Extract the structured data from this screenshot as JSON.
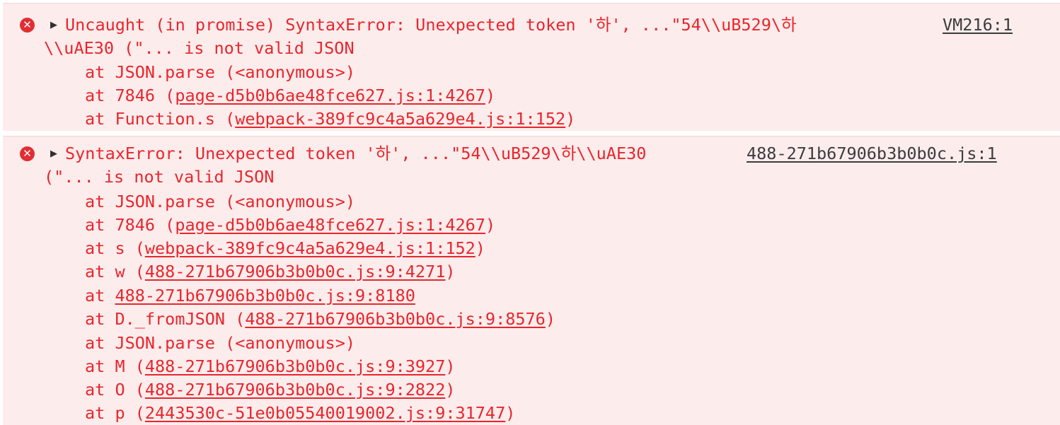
{
  "colors": {
    "error_text": "#e8262c",
    "error_bg": "#fcecec",
    "error_icon": "#e12e33",
    "link_text": "#4a4a4a"
  },
  "icons": {
    "error": "error-circle-icon",
    "expand": "expand-triangle-icon"
  },
  "entries": [
    {
      "message_line1": "Uncaught (in promise) SyntaxError: Unexpected token '하', ...\"54\\\\uB529\\하",
      "message_line2": "\\\\uAE30 (\"... is not valid JSON",
      "source": "VM216:1",
      "stack": [
        {
          "prefix": "at JSON.parse (<anonymous>)",
          "link": "",
          "suffix": ""
        },
        {
          "prefix": "at 7846 (",
          "link": "page-d5b0b6ae48fce627.js:1:4267",
          "suffix": ")"
        },
        {
          "prefix": "at Function.s (",
          "link": "webpack-389fc9c4a5a629e4.js:1:152",
          "suffix": ")"
        }
      ]
    },
    {
      "message_line1": "SyntaxError: Unexpected token '하', ...\"54\\\\uB529\\하\\\\uAE30",
      "message_line2": "(\"... is not valid JSON",
      "source": "488-271b67906b3b0b0c.js:1",
      "stack": [
        {
          "prefix": "at JSON.parse (<anonymous>)",
          "link": "",
          "suffix": ""
        },
        {
          "prefix": "at 7846 (",
          "link": "page-d5b0b6ae48fce627.js:1:4267",
          "suffix": ")"
        },
        {
          "prefix": "at s (",
          "link": "webpack-389fc9c4a5a629e4.js:1:152",
          "suffix": ")"
        },
        {
          "prefix": "at w (",
          "link": "488-271b67906b3b0b0c.js:9:4271",
          "suffix": ")"
        },
        {
          "prefix": "at ",
          "link": "488-271b67906b3b0b0c.js:9:8180",
          "suffix": ""
        },
        {
          "prefix": "at D._fromJSON (",
          "link": "488-271b67906b3b0b0c.js:9:8576",
          "suffix": ")"
        },
        {
          "prefix": "at JSON.parse (<anonymous>)",
          "link": "",
          "suffix": ""
        },
        {
          "prefix": "at M (",
          "link": "488-271b67906b3b0b0c.js:9:3927",
          "suffix": ")"
        },
        {
          "prefix": "at O (",
          "link": "488-271b67906b3b0b0c.js:9:2822",
          "suffix": ")"
        },
        {
          "prefix": "at p (",
          "link": "2443530c-51e0b05540019002.js:9:31747",
          "suffix": ")"
        }
      ]
    }
  ]
}
